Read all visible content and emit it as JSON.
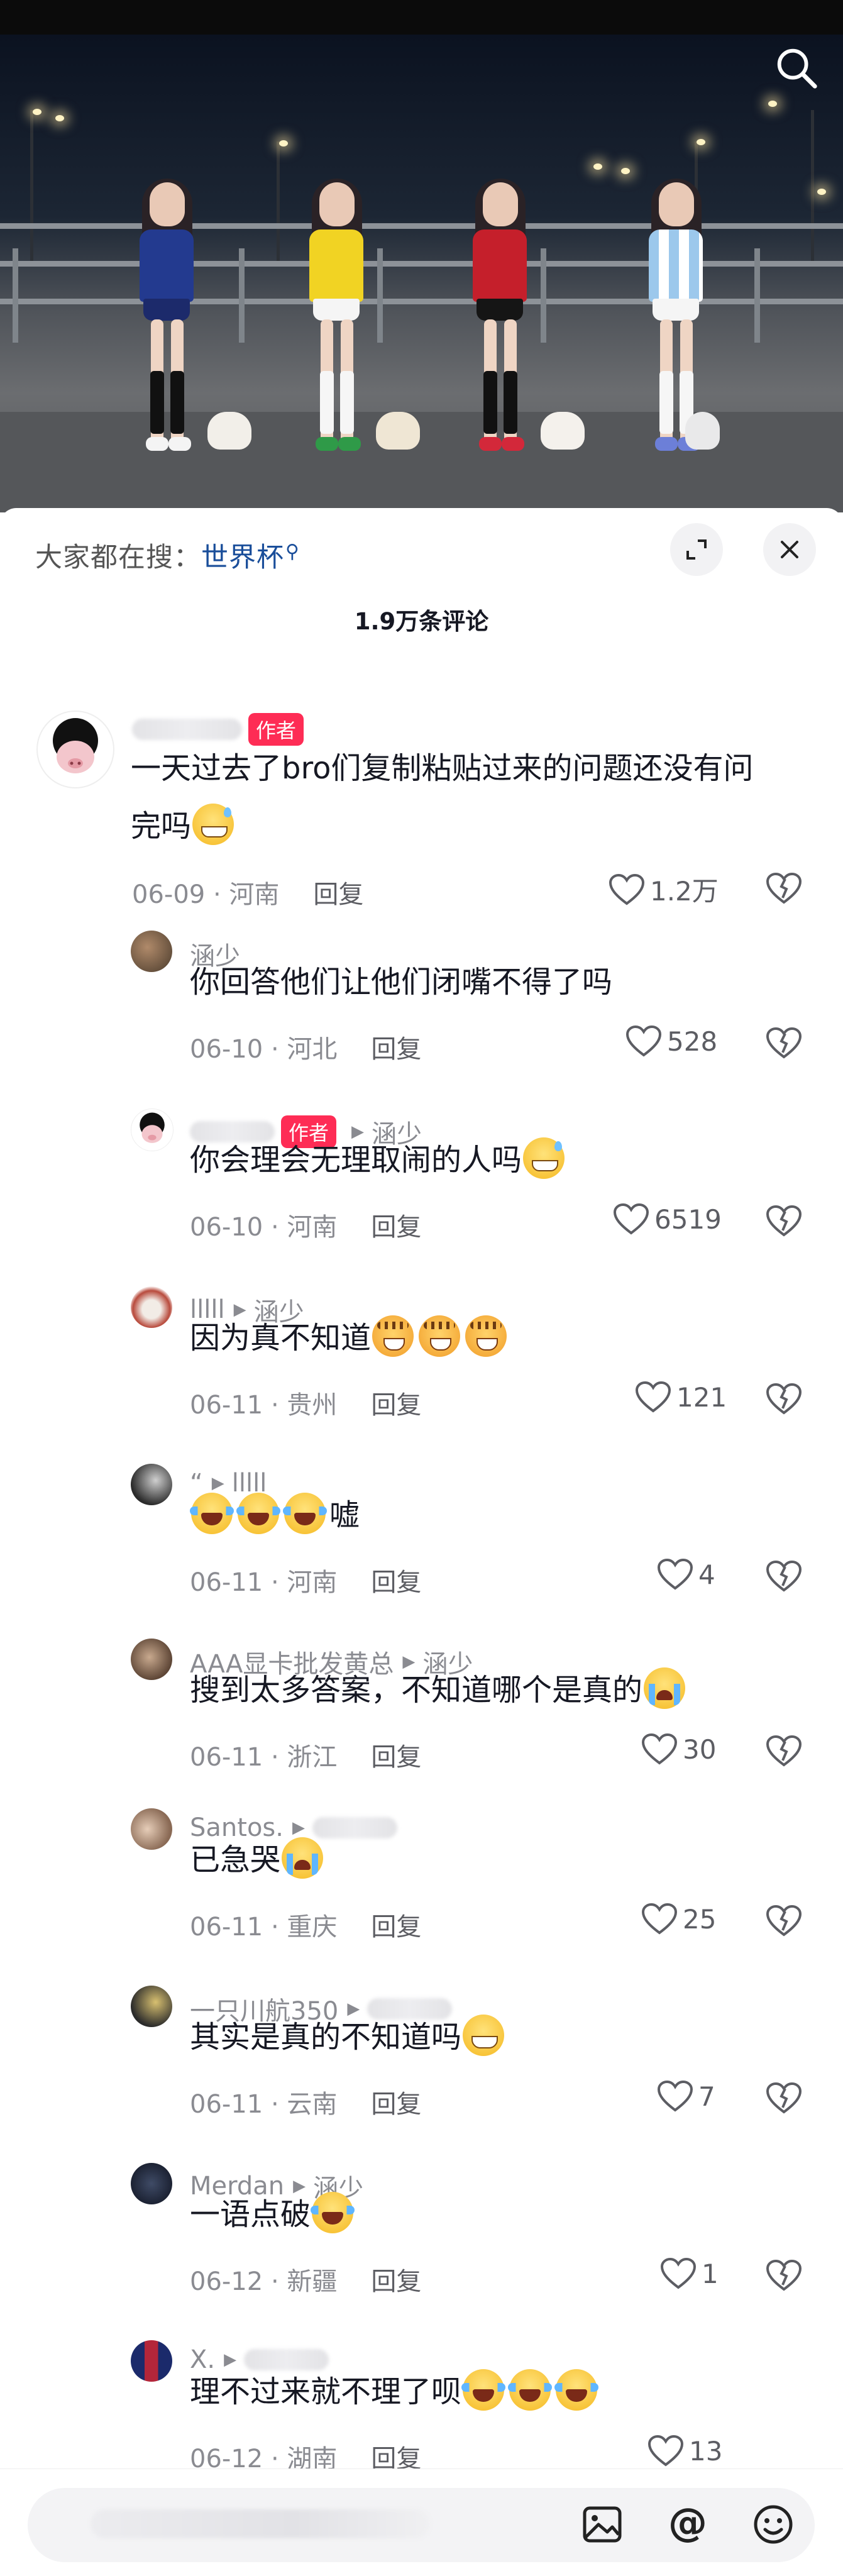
{
  "video": {
    "description_icon": "search-icon"
  },
  "panel": {
    "hot_search_label": "大家都在搜：",
    "hot_search_term": "世界杯",
    "comment_count": "1.9万条评论",
    "expand_icon": "expand-icon",
    "close_icon": "close-icon"
  },
  "comments": [
    {
      "name": "",
      "badge": "作者",
      "reply_to": "",
      "text": "一天过去了bro们复制粘贴过来的问题还没有问",
      "text2": "完吗",
      "emoji": "grin-sweat",
      "date": "06-09",
      "region": "河南",
      "reply": "回复",
      "likes": "1.2万"
    },
    {
      "name": "涵少",
      "badge": "",
      "reply_to": "",
      "text": "你回答他们让他们闭嘴不得了吗",
      "date": "06-10",
      "region": "河北",
      "reply": "回复",
      "likes": "528"
    },
    {
      "name": "",
      "badge": "作者",
      "reply_to": "涵少",
      "text": "你会理会无理取闹的人吗",
      "emoji": "grin-sweat",
      "date": "06-10",
      "region": "河南",
      "reply": "回复",
      "likes": "6519"
    },
    {
      "name": "lllll",
      "badge": "",
      "reply_to": "涵少",
      "text": "因为真不知道",
      "emoji": "tiger x3",
      "date": "06-11",
      "region": "贵州",
      "reply": "回复",
      "likes": "121"
    },
    {
      "name": "“",
      "badge": "",
      "reply_to": "lllll",
      "text": "嘘",
      "emoji": "laugh-cry x3",
      "date": "06-11",
      "region": "河南",
      "reply": "回复",
      "likes": "4"
    },
    {
      "name": "AAA显卡批发黄总",
      "badge": "",
      "reply_to": "涵少",
      "text": "搜到太多答案，不知道哪个是真的",
      "emoji": "loud-cry",
      "date": "06-11",
      "region": "浙江",
      "reply": "回复",
      "likes": "30"
    },
    {
      "name": "Santos.",
      "badge": "",
      "reply_to": "",
      "text": "已急哭",
      "emoji": "loud-cry",
      "date": "06-11",
      "region": "重庆",
      "reply": "回复",
      "likes": "25"
    },
    {
      "name": "一只川航350",
      "badge": "",
      "reply_to": "",
      "text": "其实是真的不知道吗",
      "emoji": "grin",
      "date": "06-11",
      "region": "云南",
      "reply": "回复",
      "likes": "7"
    },
    {
      "name": "Merdan",
      "badge": "",
      "reply_to": "涵少",
      "text": "一语点破",
      "emoji": "laugh-cry",
      "date": "06-12",
      "region": "新疆",
      "reply": "回复",
      "likes": "1"
    },
    {
      "name": "X.",
      "badge": "",
      "reply_to": "",
      "text": "理不过来就不理了呗",
      "emoji": "laugh-cry x3",
      "date": "06-12",
      "region": "湖南",
      "reply": "回复",
      "likes": "13"
    }
  ],
  "input": {
    "image_icon": "image-icon",
    "mention_icon": "at-icon",
    "emoji_icon": "emoji-icon"
  },
  "colors": {
    "author_badge": "#fe2c55",
    "hot_link": "#1a4e9a",
    "muted_text": "#8a8b91"
  }
}
